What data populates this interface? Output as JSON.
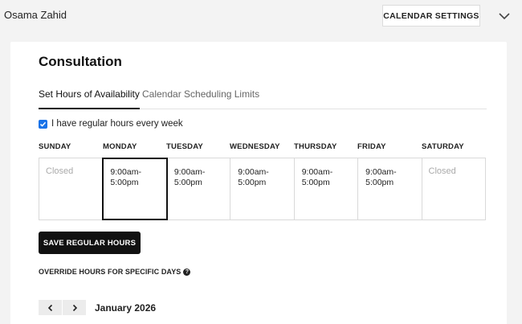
{
  "header": {
    "user_name": "Osama Zahid",
    "settings_button": "CALENDAR SETTINGS",
    "collapse_icon": "chevron-down-icon"
  },
  "card": {
    "title": "Consultation",
    "tabs": [
      {
        "label": "Set Hours of Availability",
        "active": true
      },
      {
        "label": "Calendar Scheduling Limits",
        "active": false
      }
    ],
    "regular_hours_checkbox": {
      "label": "I have regular hours every week",
      "checked": true
    },
    "days": [
      {
        "name": "SUNDAY",
        "hours": "Closed",
        "closed": true
      },
      {
        "name": "MONDAY",
        "hours": "9:00am-\n5:00pm",
        "closed": false,
        "selected": true
      },
      {
        "name": "TUESDAY",
        "hours": "9:00am-\n5:00pm",
        "closed": false
      },
      {
        "name": "WEDNESDAY",
        "hours": "9:00am-\n5:00pm",
        "closed": false
      },
      {
        "name": "THURSDAY",
        "hours": "9:00am-\n5:00pm",
        "closed": false
      },
      {
        "name": "FRIDAY",
        "hours": "9:00am-\n5:00pm",
        "closed": false
      },
      {
        "name": "SATURDAY",
        "hours": "Closed",
        "closed": true
      }
    ],
    "save_button": "SAVE REGULAR HOURS",
    "override_label": "OVERRIDE HOURS FOR SPECIFIC DAYS",
    "help_icon": "question-circle-icon",
    "month_label": "January 2026"
  },
  "colors": {
    "accent": "#1a73e8",
    "primary_button": "#111111",
    "background": "#f3f3f3"
  }
}
